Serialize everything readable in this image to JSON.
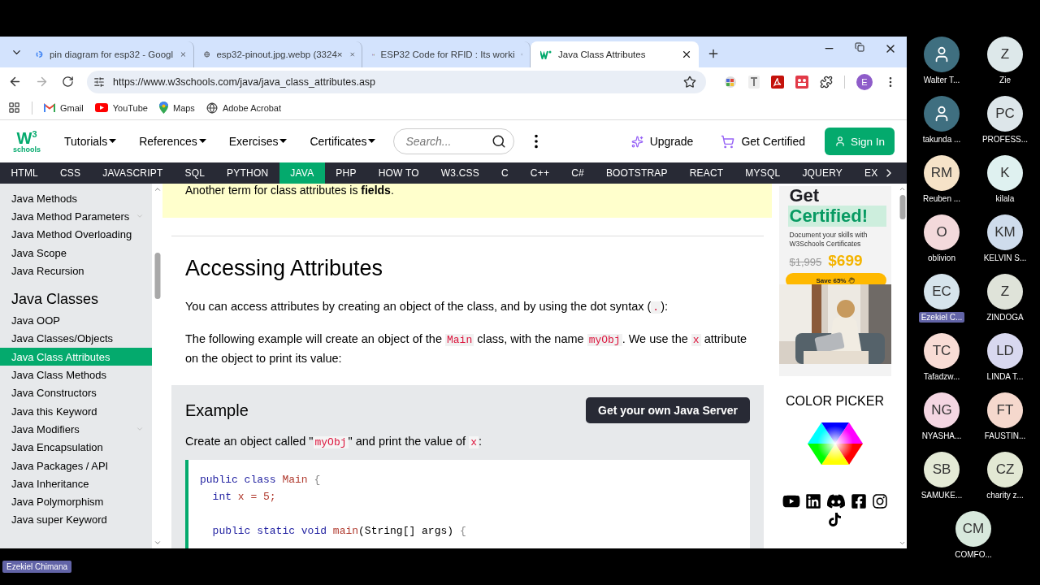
{
  "browser_tabs": [
    {
      "title": "pin diagram for esp32 - Googl",
      "kind": "google",
      "selected": false
    },
    {
      "title": "esp32-pinout.jpg.webp (3324×",
      "kind": "globe",
      "selected": false
    },
    {
      "title": "ESP32 Code for RFID : Its worki",
      "kind": "gmail",
      "selected": false
    },
    {
      "title": "Java Class Attributes",
      "kind": "w3",
      "selected": true
    }
  ],
  "address_bar": {
    "url": "https://www.w3schools.com/java/java_class_attributes.asp",
    "forward_enabled": false,
    "profile_initial": "E"
  },
  "bookmarks": [
    {
      "label": "Gmail",
      "kind": "gmail"
    },
    {
      "label": "YouTube",
      "kind": "youtube"
    },
    {
      "label": "Maps",
      "kind": "maps"
    },
    {
      "label": "Adobe Acrobat",
      "kind": "globe"
    }
  ],
  "site_header": {
    "logo": {
      "mark": "W",
      "superscript": "3",
      "word": "schools"
    },
    "menus": [
      "Tutorials",
      "References",
      "Exercises",
      "Certificates"
    ],
    "search": {
      "placeholder": "Search..."
    },
    "upgrade": "Upgrade",
    "get_certified": "Get Certified",
    "sign_in": "Sign In"
  },
  "nav": [
    {
      "label": "HTML",
      "selected": false
    },
    {
      "label": "CSS",
      "selected": false
    },
    {
      "label": "JAVASCRIPT",
      "selected": false
    },
    {
      "label": "SQL",
      "selected": false
    },
    {
      "label": "PYTHON",
      "selected": false
    },
    {
      "label": "JAVA",
      "selected": true
    },
    {
      "label": "PHP",
      "selected": false
    },
    {
      "label": "HOW TO",
      "selected": false
    },
    {
      "label": "W3.CSS",
      "selected": false
    },
    {
      "label": "C",
      "selected": false
    },
    {
      "label": "C++",
      "selected": false
    },
    {
      "label": "C#",
      "selected": false
    },
    {
      "label": "BOOTSTRAP",
      "selected": false
    },
    {
      "label": "REACT",
      "selected": false
    },
    {
      "label": "MYSQL",
      "selected": false
    },
    {
      "label": "JQUERY",
      "selected": false
    },
    {
      "label": "EX",
      "selected": false
    }
  ],
  "sidebar": {
    "groups": [
      {
        "items": [
          {
            "label": "Java Methods",
            "selected": false,
            "caret": false
          },
          {
            "label": "Java Method Parameters",
            "selected": false,
            "caret": true
          },
          {
            "label": "Java Method Overloading",
            "selected": false,
            "caret": false
          },
          {
            "label": "Java Scope",
            "selected": false,
            "caret": false
          },
          {
            "label": "Java Recursion",
            "selected": false,
            "caret": false
          }
        ]
      },
      {
        "heading": "Java Classes",
        "items": [
          {
            "label": "Java OOP",
            "selected": false,
            "caret": false
          },
          {
            "label": "Java Classes/Objects",
            "selected": false,
            "caret": false
          },
          {
            "label": "Java Class Attributes",
            "selected": true,
            "caret": false
          },
          {
            "label": "Java Class Methods",
            "selected": false,
            "caret": false
          },
          {
            "label": "Java Constructors",
            "selected": false,
            "caret": false
          },
          {
            "label": "Java this Keyword",
            "selected": false,
            "caret": false
          },
          {
            "label": "Java Modifiers",
            "selected": false,
            "caret": true
          },
          {
            "label": "Java Encapsulation",
            "selected": false,
            "caret": false
          },
          {
            "label": "Java Packages / API",
            "selected": false,
            "caret": false
          },
          {
            "label": "Java Inheritance",
            "selected": false,
            "caret": false
          },
          {
            "label": "Java Polymorphism",
            "selected": false,
            "caret": false
          },
          {
            "label": "Java super Keyword",
            "selected": false,
            "caret": false
          }
        ]
      }
    ]
  },
  "note": "Another term for class attributes is **fields**.",
  "section_title": "Accessing Attributes",
  "paragraphs": [
    [
      {
        "text": "You can access attributes by creating an object of the class, and by using the dot syntax (",
        "code": false
      },
      {
        "text": ".",
        "code": true
      },
      {
        "text": "):",
        "code": false
      }
    ],
    [
      {
        "text": "The following example will create an object of the ",
        "code": false
      },
      {
        "text": "Main",
        "code": true
      },
      {
        "text": " class, with the name ",
        "code": false
      },
      {
        "text": "myObj",
        "code": true
      },
      {
        "text": ". We use the ",
        "code": false
      },
      {
        "text": "x",
        "code": true
      },
      {
        "text": " attribute on the object to print its value:",
        "code": false
      }
    ]
  ],
  "example": {
    "title": "Example",
    "server_button": "Get your own Java Server",
    "intro": [
      {
        "text": "Create an object called \"",
        "code": false
      },
      {
        "text": "myObj",
        "code": true
      },
      {
        "text": "\" and print the value of ",
        "code": false
      },
      {
        "text": "x",
        "code": true
      },
      {
        "text": ":",
        "code": false
      }
    ],
    "code": [
      {
        "kind": "code",
        "tokens": [
          {
            "kind": "keyword",
            "text": "public class "
          },
          {
            "kind": "ident",
            "text": "Main "
          },
          {
            "kind": "punct",
            "text": "{"
          }
        ]
      },
      {
        "kind": "code",
        "tokens": [
          {
            "kind": "keyword",
            "text": "  int "
          },
          {
            "kind": "ident",
            "text": "x = 5;"
          }
        ]
      },
      {
        "kind": "blank"
      },
      {
        "kind": "code",
        "tokens": [
          {
            "kind": "keyword",
            "text": "  public static void "
          },
          {
            "kind": "ident",
            "text": "main"
          },
          {
            "kind": "plain",
            "text": "(String[] args) "
          },
          {
            "kind": "punct",
            "text": "{"
          }
        ]
      }
    ]
  },
  "ad": {
    "title": "Get",
    "highlight": "Certified!",
    "text": "Document your skills with W3Schools Certificates",
    "old_price": "$1,995",
    "price": "$699",
    "button": "Save 65%"
  },
  "color_picker": {
    "title": "COLOR PICKER"
  },
  "participants": [
    {
      "kind": "silhouette",
      "name": "Walter T...",
      "color": "#3f6f80",
      "selected": false
    },
    {
      "kind": "initials",
      "initials": "Z",
      "name": "Zie",
      "color": "#dde8ea",
      "selected": false
    },
    {
      "kind": "silhouette",
      "name": "takunda ...",
      "color": "#3f6f80",
      "selected": false
    },
    {
      "kind": "initials",
      "initials": "PC",
      "name": "PROFESS...",
      "color": "#dde6ea",
      "selected": false
    },
    {
      "kind": "initials",
      "initials": "RM",
      "name": "Reuben ...",
      "color": "#f6e3c8",
      "selected": false
    },
    {
      "kind": "initials",
      "initials": "K",
      "name": "kilala",
      "color": "#dff1f0",
      "selected": false
    },
    {
      "kind": "initials",
      "initials": "O",
      "name": "oblivion",
      "color": "#f3d9db",
      "selected": false
    },
    {
      "kind": "initials",
      "initials": "KM",
      "name": "KELVIN S...",
      "color": "#cfdcec",
      "selected": false
    },
    {
      "kind": "initials",
      "initials": "EC",
      "name": "Ezekiel C...",
      "color": "#d6e4ec",
      "selected": true
    },
    {
      "kind": "initials",
      "initials": "Z",
      "name": "ZINDOGA",
      "color": "#dfe3d9",
      "selected": false
    },
    {
      "kind": "initials",
      "initials": "TC",
      "name": "Tafadzw...",
      "color": "#f8dcd5",
      "selected": false
    },
    {
      "kind": "initials",
      "initials": "LD",
      "name": "LINDA T...",
      "color": "#d8d8ef",
      "selected": false
    },
    {
      "kind": "initials",
      "initials": "NG",
      "name": "NYASHA...",
      "color": "#f4d6e2",
      "selected": false
    },
    {
      "kind": "initials",
      "initials": "FT",
      "name": "FAUSTIN...",
      "color": "#f5d8cd",
      "selected": false
    },
    {
      "kind": "initials",
      "initials": "SB",
      "name": "SAMUKE...",
      "color": "#e4ead6",
      "selected": false
    },
    {
      "kind": "initials",
      "initials": "CZ",
      "name": "charity z...",
      "color": "#e2e8d4",
      "selected": false
    },
    {
      "kind": "initials",
      "initials": "CM",
      "name": "COMFO...",
      "color": "#d7e8dc",
      "selected": false
    }
  ],
  "presenter": "Ezekiel Chimana"
}
